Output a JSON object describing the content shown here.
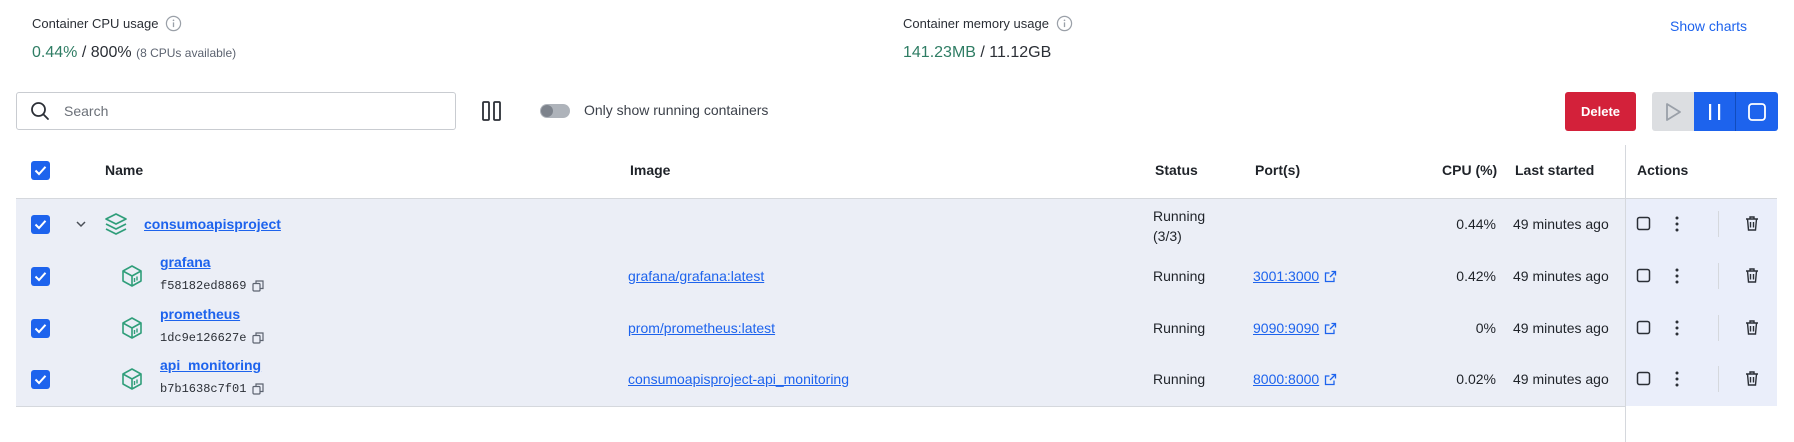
{
  "stats": {
    "cpu": {
      "label": "Container CPU usage",
      "value": "0.44%",
      "total": " / 800%",
      "sub": "(8 CPUs available)"
    },
    "memory": {
      "label": "Container memory usage",
      "value": "141.23MB",
      "total": " / 11.12GB"
    },
    "show_charts": "Show charts"
  },
  "toolbar": {
    "search_placeholder": "Search",
    "running_toggle_label": "Only show running containers",
    "delete_label": "Delete"
  },
  "table": {
    "headers": {
      "name": "Name",
      "image": "Image",
      "status": "Status",
      "ports": "Port(s)",
      "cpu": "CPU (%)",
      "last_started": "Last started",
      "actions": "Actions"
    },
    "group": {
      "name": "consumoapisproject",
      "status_line1": "Running",
      "status_line2": "(3/3)",
      "cpu": "0.44%",
      "last_started": "49 minutes ago"
    },
    "rows": [
      {
        "name": "grafana",
        "id": "f58182ed8869",
        "image": "grafana/grafana:latest",
        "status": "Running",
        "port": "3001:3000",
        "cpu": "0.42%",
        "last_started": "49 minutes ago"
      },
      {
        "name": "prometheus",
        "id": "1dc9e126627e",
        "image": "prom/prometheus:latest",
        "status": "Running",
        "port": "9090:9090",
        "cpu": "0%",
        "last_started": "49 minutes ago"
      },
      {
        "name": "api_monitoring",
        "id": "b7b1638c7f01",
        "image": "consumoapisproject-api_monitoring",
        "status": "Running",
        "port": "8000:8000",
        "cpu": "0.02%",
        "last_started": "49 minutes ago"
      }
    ]
  },
  "colors": {
    "accent": "#1d63ed",
    "danger": "#d3213a",
    "stat_value": "#2f7d64",
    "row_highlight": "#ebeef6"
  }
}
